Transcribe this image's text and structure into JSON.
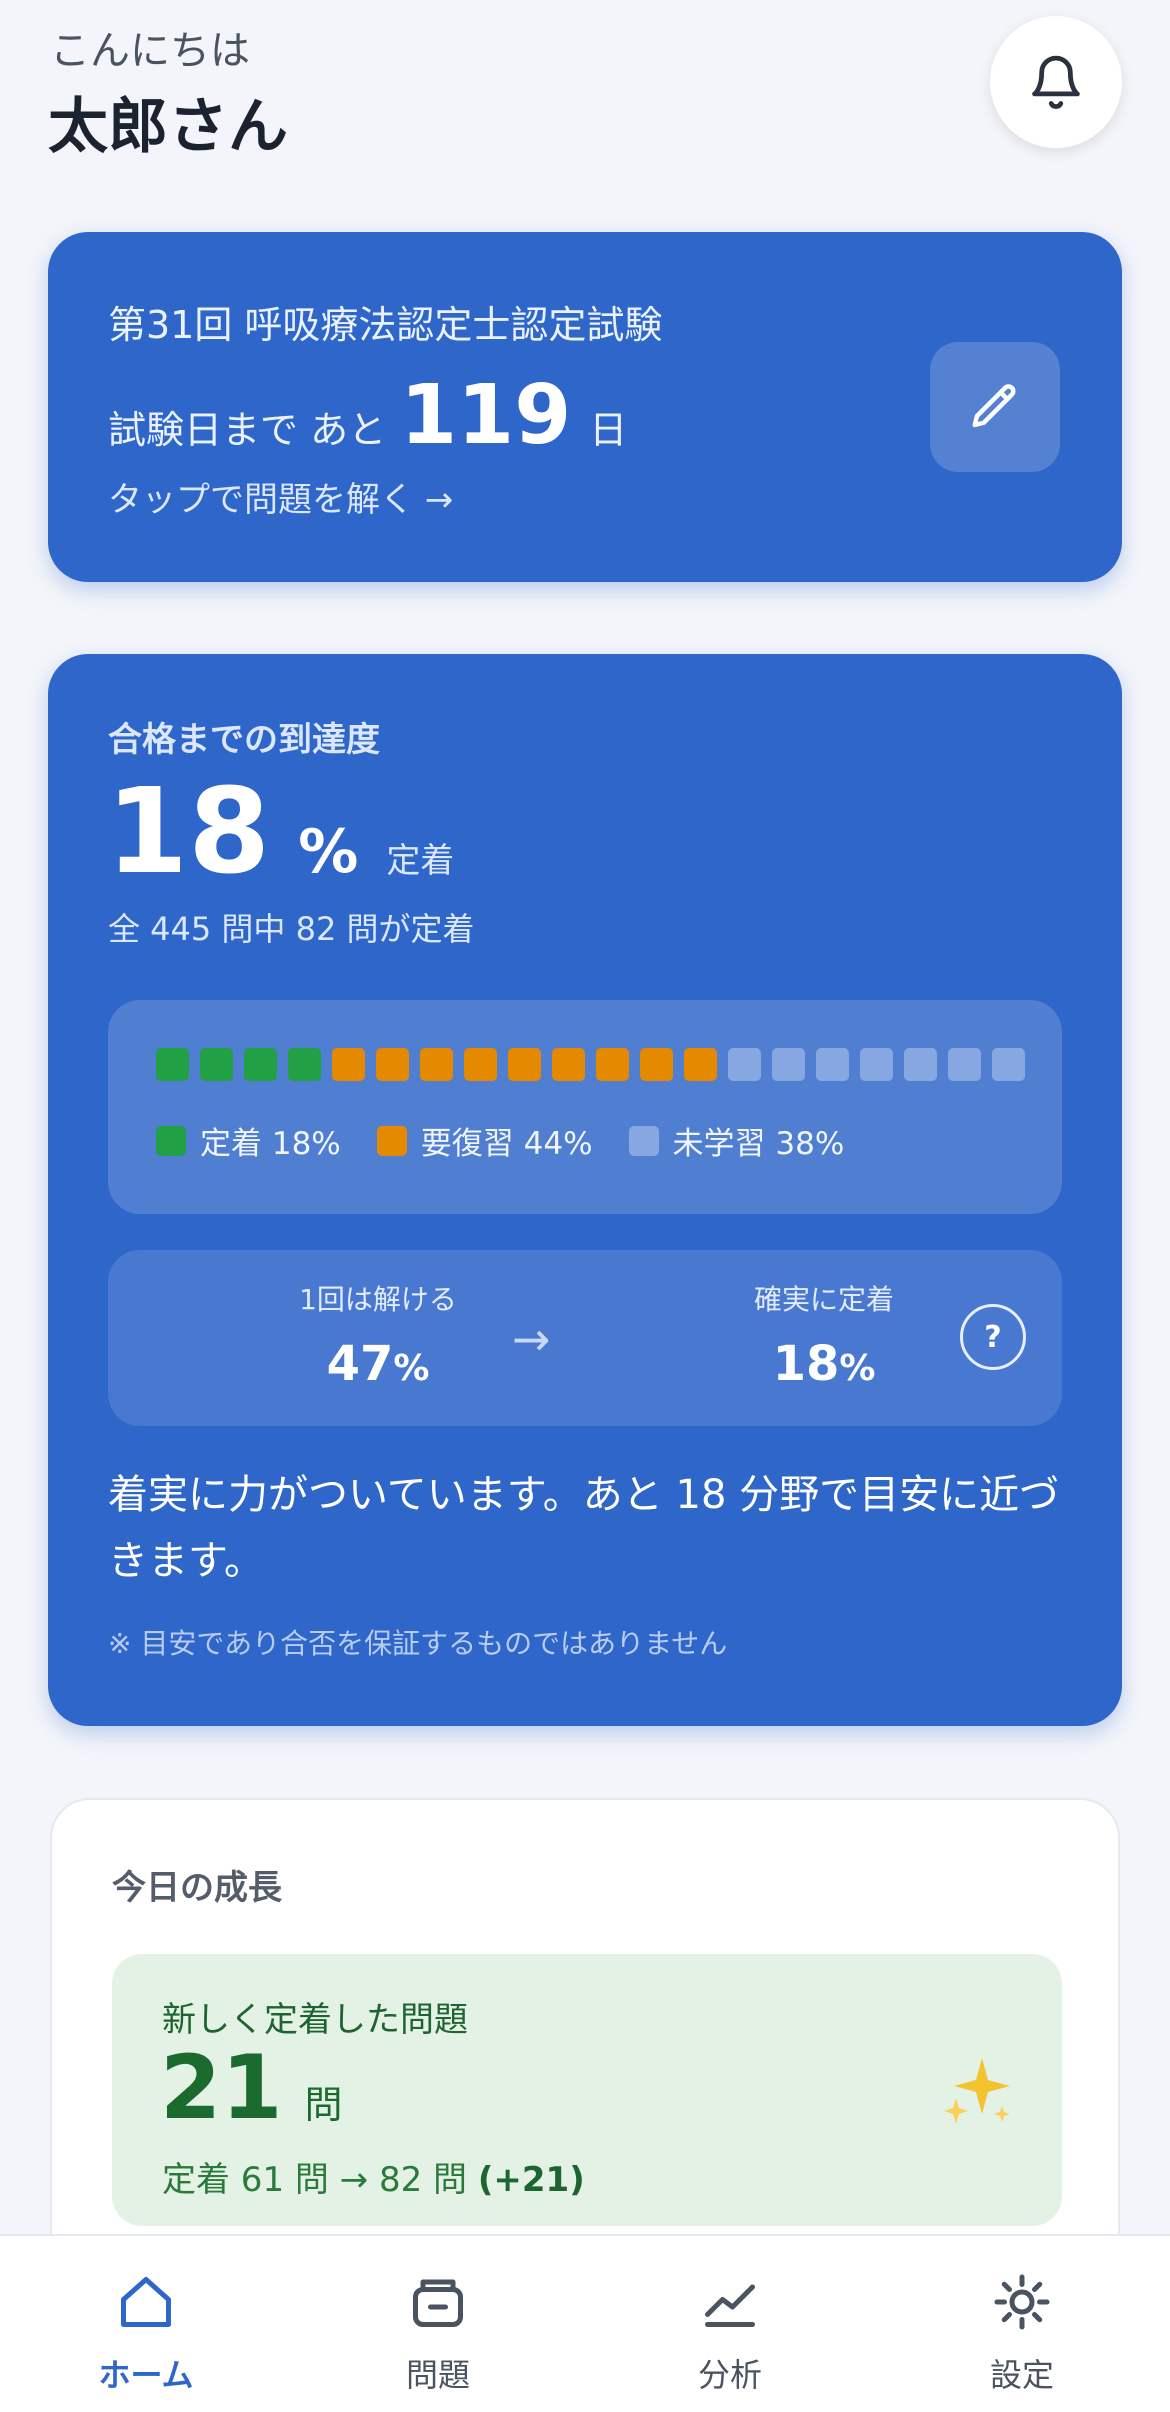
{
  "header": {
    "greeting": "こんにちは",
    "username": "太郎さん",
    "bell_icon": "bell-icon"
  },
  "exam": {
    "title": "第31回 呼吸療法認定士認定試験",
    "countdown_prefix": "試験日まで あと",
    "days": "119",
    "days_unit": "日",
    "tap_hint": "タップで問題を解く →",
    "edit_icon": "pencil-icon"
  },
  "progress": {
    "label": "合格までの到達度",
    "percent": "18",
    "percent_sign": "%",
    "percent_label": "定着",
    "summary": "全 445 問中 82 問が定着",
    "segments": {
      "mastered": 4,
      "review": 9,
      "unlearned": 7
    },
    "legend": {
      "mastered": "定着 18%",
      "review": "要復習 44%",
      "unlearned": "未学習 38%"
    },
    "colors": {
      "mastered": "#22a045",
      "review": "#e58a00",
      "unlearned": "#86a7e2",
      "card": "#2f66c9"
    },
    "compare": {
      "left_caption": "1回は解ける",
      "left_value": "47",
      "right_caption": "確実に定着",
      "right_value": "18",
      "unit": "%",
      "arrow": "→",
      "help": "?"
    },
    "message": "着実に力がついています。あと 18 分野で目安に近づきます。",
    "disclaimer": "※ 目安であり合否を保証するものではありません"
  },
  "today": {
    "title": "今日の成長",
    "new_mastered_caption": "新しく定着した問題",
    "new_mastered_count": "21",
    "new_mastered_unit": "問",
    "delta_text": "定着 61 問 → 82 問",
    "delta_badge": "(+21)",
    "sparkle_icon": "sparkles-icon"
  },
  "nav": {
    "items": [
      {
        "label": "ホーム",
        "icon": "home-icon",
        "active": true
      },
      {
        "label": "問題",
        "icon": "question-box-icon",
        "active": false
      },
      {
        "label": "分析",
        "icon": "chart-line-icon",
        "active": false
      },
      {
        "label": "設定",
        "icon": "gear-icon",
        "active": false
      }
    ]
  }
}
